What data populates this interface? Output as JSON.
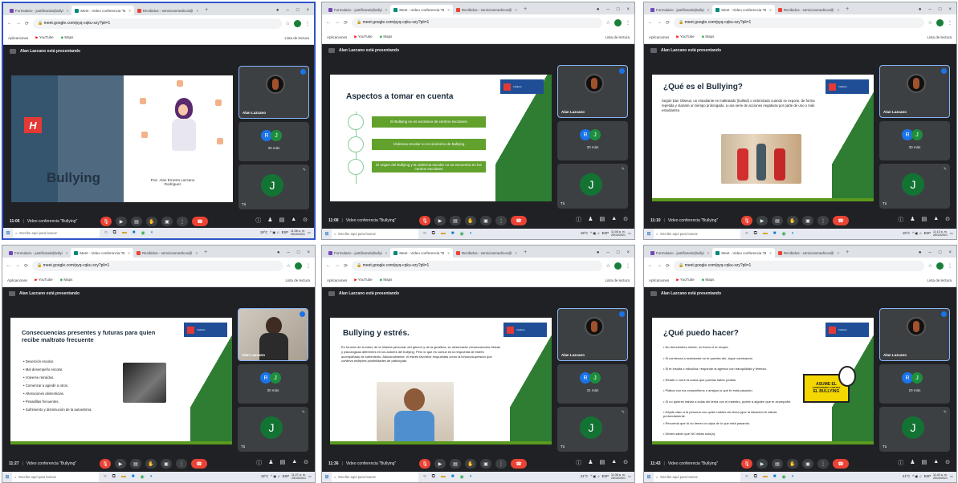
{
  "browser": {
    "tabs": [
      "Formulario - justificando(bullyi",
      "Meet - Video conferencia \"B",
      "Recibidos - serviciosmedicos@"
    ],
    "url": "meet.google.com/pyq-cqku-xzy?pli=1",
    "bookmarks": [
      "Aplicaciones",
      "YouTube",
      "Maps"
    ],
    "reading_list": "Lista de lectura"
  },
  "meet": {
    "presenting": "Alan Lazcano está presentando",
    "conference": "Video conferencia \"Bullying\"",
    "participant_name": "Alan Lazcano",
    "initials": [
      "R",
      "J"
    ],
    "self_initial": "J",
    "self_label": "Tú"
  },
  "taskbar": {
    "search": "Escribe aquí para buscar",
    "lang": "ESP"
  },
  "screens": [
    {
      "time": "11:06",
      "others": "30 más",
      "temp": "19°C",
      "clock": "11:06 a. m.",
      "date": "25/10/2021",
      "slide": {
        "title": "Bullying",
        "author": "Psic. Alan Ernesto Lazcano Rodríguez"
      }
    },
    {
      "time": "11:08",
      "others": "30 más",
      "temp": "19°C",
      "clock": "11:08 a. m.",
      "date": "25/10/2021",
      "slide": {
        "title": "Aspectos a tomar en cuenta",
        "items": [
          "El Bullying no es exclusivo de centros escolares",
          "Violencia escolar no es sinónimo de Bullying",
          "El origen del Bullying y la violencia escolar no se encuentra en los centros escolares"
        ]
      }
    },
    {
      "time": "11:10",
      "others": "30 más",
      "temp": "19°C",
      "clock": "11:10 a. m.",
      "date": "25/10/2021",
      "slide": {
        "title": "¿Qué es el Bullying?",
        "text": "Según Dan Olweus, un estudiante es maltratado (bullied) o victimizado cuando se expone, de forma repetida y durante un tiempo prolongado, a una serie de acciones negativas por parte de uno o más estudiantes."
      }
    },
    {
      "time": "11:27",
      "others": "30 más",
      "temp": "19°C",
      "clock": "11:27 a. m.",
      "date": "25/10/2021",
      "slide": {
        "title": "Consecuencias presentes y futuras para quien recibe maltrato frecuente",
        "items": [
          "Deserción escolar.",
          "Mal desempeño escolar.",
          "Volverse retraídos.",
          "Comenzar a agredir a otros.",
          "Alteraciones alimenticias.",
          "Pesadillas frecuentes.",
          "Sufrimiento y disminución de la autoestima."
        ]
      }
    },
    {
      "time": "11:36",
      "others": "31 más",
      "temp": "21°C",
      "clock": "11:36 a. m.",
      "date": "25/10/2021",
      "slide": {
        "title": "Bullying y estrés.",
        "text": "En función de la edad, de la historia personal, del género y de la genética, se observarán consecuencias físicas y psicológicas diferentes en los actores del bullying. Pero lo que es común es la respuesta de estrés acompañado de sufrimiento. Adicionalmente, el estrés favorece respuestas como la inmunosupresión que conlleva múltiples posibilidades de patologías."
      }
    },
    {
      "time": "11:43",
      "others": "29 más",
      "temp": "21°C",
      "clock": "11:43 a. m.",
      "date": "25/10/2021",
      "slide": {
        "title": "¿Qué puedo hacer?",
        "items": [
          "No demuestres miedo, no llores ni te enojes.",
          "Si comienza a molestarte no te quedes ahí, sigue caminando.",
          "Si te insulta o ridiculiza, responde al agresor con tranquilidad y firmeza.",
          "Rétate o corre la cosas que puedas haber pedido.",
          "Platica con tus compañeros o amigos lo que te está pasando.",
          "Si no quieres hablar a solas del tema con el maestro, pídele a alguien que te acompañe.",
          "Déjale claro a la persona con quién hables del tema (que la situación te afecta profundamente.",
          "Recuerda que tú no tienes la culpa de lo que está pasando.",
          "Debes saber que NO estás solo(a)."
        ],
        "banner": [
          "ASUME EL",
          "COMPROMISO CONTRA",
          "EL BULLYING"
        ]
      }
    }
  ]
}
